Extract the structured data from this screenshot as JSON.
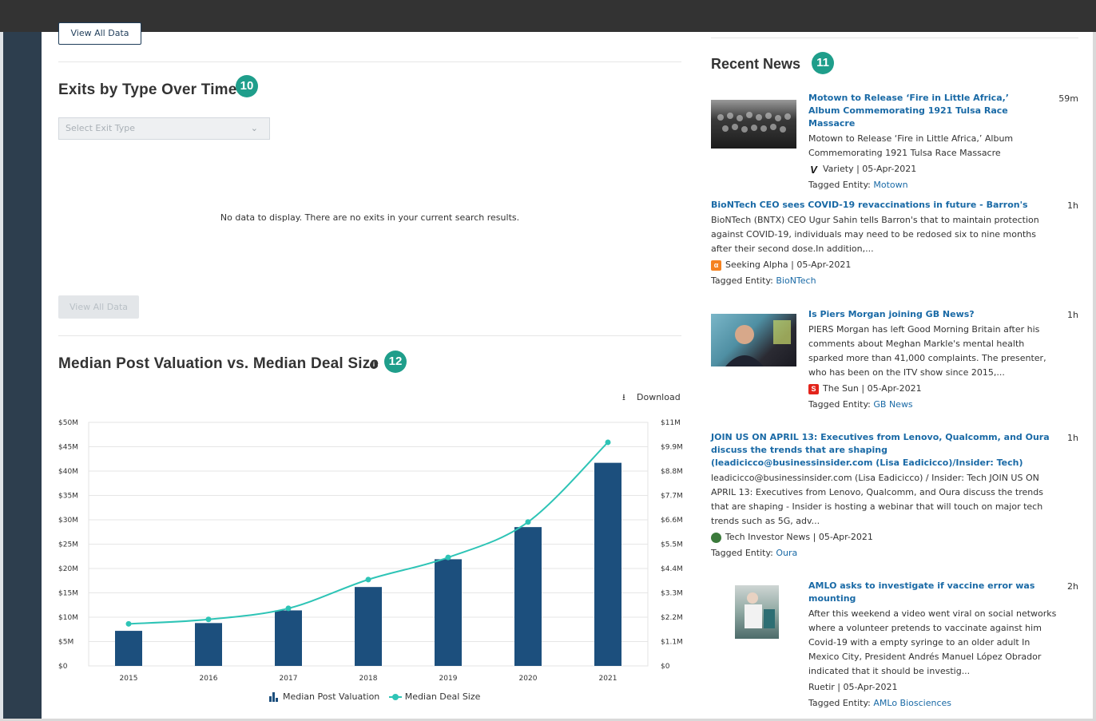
{
  "top": {
    "view_all_label": "View All Data"
  },
  "exits": {
    "title": "Exits by Type Over Time",
    "badge": "10",
    "select_placeholder": "Select Exit Type",
    "no_data": "No data to display. There are no exits in your current search results.",
    "view_all_label": "View All Data"
  },
  "valuation": {
    "title": "Median Post Valuation vs. Median Deal Size",
    "badge": "12",
    "info_glyph": "i",
    "download_label": "Download"
  },
  "chart_data": {
    "type": "bar",
    "categories": [
      "2015",
      "2016",
      "2017",
      "2018",
      "2019",
      "2020",
      "2021"
    ],
    "series": [
      {
        "name": "Median Post Valuation",
        "type": "bar",
        "axis": "left",
        "values": [
          7.2,
          8.8,
          11.4,
          16.2,
          21.9,
          28.5,
          41.7
        ]
      },
      {
        "name": "Median Deal Size",
        "type": "line",
        "axis": "right",
        "values": [
          1.9,
          2.1,
          2.6,
          3.9,
          4.9,
          6.5,
          10.1
        ]
      }
    ],
    "left_axis": {
      "ticks": [
        "$0",
        "$5M",
        "$10M",
        "$15M",
        "$20M",
        "$25M",
        "$30M",
        "$35M",
        "$40M",
        "$45M",
        "$50M"
      ],
      "ylim": [
        0,
        50
      ]
    },
    "right_axis": {
      "ticks": [
        "$0",
        "$1.1M",
        "$2.2M",
        "$3.3M",
        "$4.4M",
        "$5.5M",
        "$6.6M",
        "$7.7M",
        "$8.8M",
        "$9.9M",
        "$11M"
      ],
      "ylim": [
        0,
        11
      ]
    },
    "grid": true,
    "legend_position": "bottom-center",
    "colors": {
      "bar": "#1c4f7d",
      "line": "#2ec4b6"
    }
  },
  "news": {
    "title": "Recent News",
    "badge": "11",
    "items": [
      {
        "headline": "Motown to Release ‘Fire in Little Africa,’ Album Commemorating 1921 Tulsa Race Massacre",
        "time": "59m",
        "body": "Motown to Release ‘Fire in Little Africa,’ Album Commemorating 1921 Tulsa Race Massacre",
        "source": "Variety | 05-Apr-2021",
        "source_icon": "V",
        "tag_label": "Tagged Entity: ",
        "entity": "Motown"
      },
      {
        "headline": "BioNTech CEO sees COVID-19 revaccinations in future - Barron's",
        "time": "1h",
        "body": "BioNTech (BNTX) CEO Ugur Sahin tells Barron's that to maintain protection against COVID-19, individuals may need to be redosed six to nine months after their second dose.In addition,...",
        "source": "Seeking Alpha | 05-Apr-2021",
        "source_icon": "α",
        "tag_label": "Tagged Entity: ",
        "entity": "BioNTech"
      },
      {
        "headline": "Is Piers Morgan joining GB News?",
        "time": "1h",
        "body": "PIERS Morgan has left Good Morning Britain after his comments about Meghan Markle's mental health sparked more than 41,000 complaints. The presenter, who has been on the ITV show since 2015,...",
        "source": "The Sun | 05-Apr-2021",
        "source_icon": "S",
        "tag_label": "Tagged Entity: ",
        "entity": "GB News"
      },
      {
        "headline": "JOIN US ON APRIL 13: Executives from Lenovo, Qualcomm, and Oura discuss the trends that are shaping (leadicicco@businessinsider.com (Lisa Eadicicco)/Insider: Tech)",
        "time": "1h",
        "body": "leadicicco@businessinsider.com (Lisa Eadicicco) / Insider: Tech JOIN US ON APRIL 13: Executives from Lenovo, Qualcomm, and Oura discuss the trends that are shaping - Insider is hosting a webinar that will touch on major tech trends such as 5G, adv...",
        "source": "Tech Investor News | 05-Apr-2021",
        "source_icon": "",
        "tag_label": "Tagged Entity: ",
        "entity": "Oura"
      },
      {
        "headline": "AMLO asks to investigate if vaccine error was mounting",
        "time": "2h",
        "body": "After this weekend a video went viral on social networks where a volunteer pretends to vaccinate against him Covid-19 with a empty syringe to an older adult In Mexico City, President Andrés Manuel López Obrador indicated that it should be investig...",
        "source": "Ruetir | 05-Apr-2021",
        "source_icon": "",
        "tag_label": "Tagged Entity: ",
        "entity": "AMLo Biosciences"
      }
    ]
  }
}
